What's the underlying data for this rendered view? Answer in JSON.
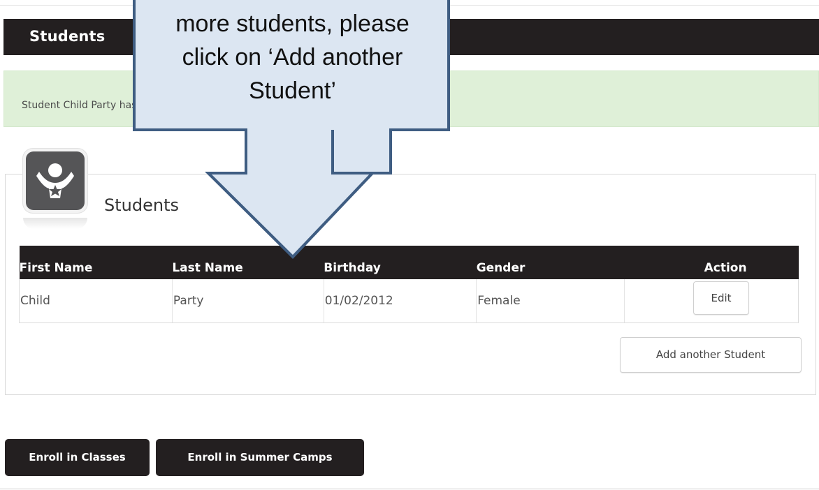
{
  "header": {
    "title": "Students"
  },
  "alert": {
    "text": "Student Child Party has been saved."
  },
  "panel": {
    "title": "Students"
  },
  "table": {
    "columns": [
      "First Name",
      "Last Name",
      "Birthday",
      "Gender",
      "Action"
    ],
    "rows": [
      {
        "first_name": "Child",
        "last_name": "Party",
        "birthday": "01/02/2012",
        "gender": "Female",
        "action": "Edit"
      }
    ]
  },
  "buttons": {
    "add_student": "Add another Student",
    "enroll_classes": "Enroll in Classes",
    "enroll_camps": "Enroll in Summer Camps"
  },
  "callout": {
    "lines": [
      "more students, please",
      "click on ‘Add another",
      "Student’"
    ]
  },
  "colors": {
    "dark_bar": "#231f20",
    "alert_bg": "#dff0d8",
    "callout_fill": "#dce6f2",
    "callout_stroke": "#3f5d82"
  }
}
